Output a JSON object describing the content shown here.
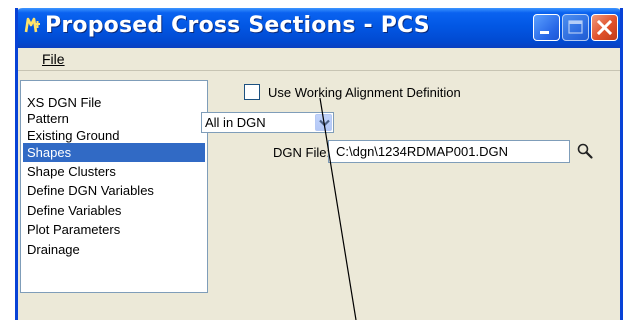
{
  "window": {
    "title": "Proposed Cross Sections - PCS",
    "controls": [
      "minimize-icon",
      "maximize-icon",
      "close-icon"
    ]
  },
  "menu": {
    "file": "File"
  },
  "list": {
    "items": [
      "XS DGN File",
      "Pattern",
      "Existing Ground",
      "Shapes",
      "Shape Clusters",
      "Define DGN Variables",
      "Define Variables",
      "Plot Parameters",
      "Drainage"
    ],
    "selected": "Shapes"
  },
  "options": {
    "use_working_alignment_label": "Use Working Alignment Definition",
    "use_working_alignment_checked": false,
    "mode_selected": "All in DGN",
    "dgn_file_label": "DGN File:",
    "dgn_file_value": "C:\\dgn\\1234RDMAP001.DGN"
  },
  "icons": {
    "app": "app-logo-icon",
    "browse": "search-icon",
    "dropdown": "chevron-down-icon"
  },
  "colors": {
    "titlebar": "#0257e4",
    "selection": "#316ac5",
    "close": "#e0512a",
    "window_bg": "#ece9d8"
  }
}
